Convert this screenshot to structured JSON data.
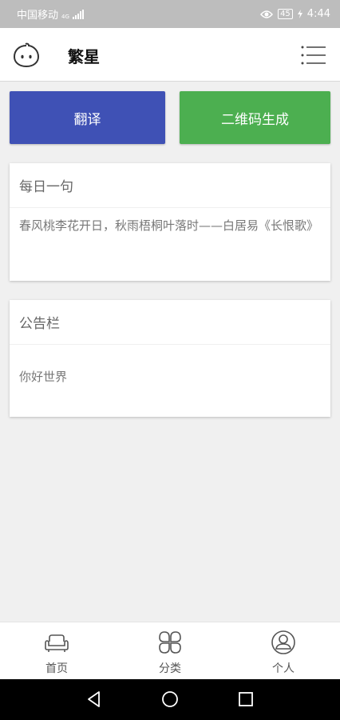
{
  "status_bar": {
    "carrier": "中国移动",
    "network": "4G",
    "battery": "45",
    "time": "4:44"
  },
  "app_bar": {
    "title": "繁星"
  },
  "actions": {
    "translate_label": "翻译",
    "qr_label": "二维码生成",
    "translate_color": "#3f51b5",
    "qr_color": "#4caf50"
  },
  "daily_card": {
    "title": "每日一句",
    "content": "春风桃李花开日，秋雨梧桐叶落时——白居易《长恨歌》"
  },
  "notice_card": {
    "title": "公告栏",
    "content": "你好世界"
  },
  "bottom_nav": {
    "items": [
      {
        "label": "首页",
        "icon": "sofa-icon"
      },
      {
        "label": "分类",
        "icon": "clover-icon"
      },
      {
        "label": "个人",
        "icon": "person-icon"
      }
    ]
  }
}
